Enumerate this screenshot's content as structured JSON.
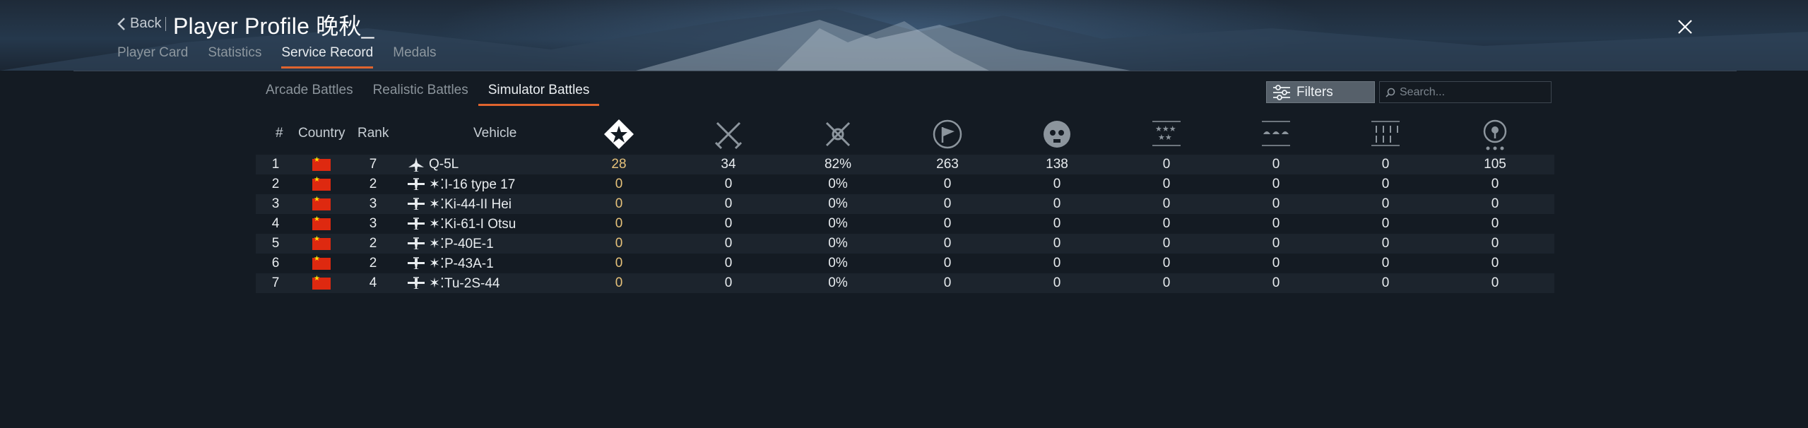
{
  "header": {
    "back_label": "Back",
    "title": "Player Profile 晚秋_",
    "tabs": [
      {
        "label": "Player Card",
        "active": false
      },
      {
        "label": "Statistics",
        "active": false
      },
      {
        "label": "Service Record",
        "active": true
      },
      {
        "label": "Medals",
        "active": false
      }
    ]
  },
  "battle_tabs": [
    {
      "label": "Arcade Battles",
      "active": false
    },
    {
      "label": "Realistic Battles",
      "active": false
    },
    {
      "label": "Simulator Battles",
      "active": true
    }
  ],
  "filters_label": "Filters",
  "search": {
    "placeholder": "Search...",
    "value": ""
  },
  "table": {
    "columns": {
      "index": "#",
      "country": "Country",
      "rank": "Rank",
      "vehicle": "Vehicle"
    },
    "stat_icons": [
      "battles-icon",
      "victories-icon",
      "win-rate-icon",
      "missions-icon",
      "kills-icon",
      "air-kills-icon",
      "ground-kills-icon",
      "naval-kills-icon",
      "activity-icon"
    ],
    "rows": [
      {
        "index": "1",
        "country": "China",
        "rank": "7",
        "vehicle": "Q-5L",
        "vehicle_type": "jet",
        "stats": [
          "28",
          "34",
          "82%",
          "263",
          "138",
          "0",
          "0",
          "0",
          "105"
        ]
      },
      {
        "index": "2",
        "country": "China",
        "rank": "2",
        "vehicle": "I-16 type 17",
        "vehicle_type": "prop",
        "stats": [
          "0",
          "0",
          "0%",
          "0",
          "0",
          "0",
          "0",
          "0",
          "0"
        ]
      },
      {
        "index": "3",
        "country": "China",
        "rank": "3",
        "vehicle": "Ki-44-II Hei",
        "vehicle_type": "prop",
        "stats": [
          "0",
          "0",
          "0%",
          "0",
          "0",
          "0",
          "0",
          "0",
          "0"
        ]
      },
      {
        "index": "4",
        "country": "China",
        "rank": "3",
        "vehicle": "Ki-61-I Otsu",
        "vehicle_type": "prop",
        "stats": [
          "0",
          "0",
          "0%",
          "0",
          "0",
          "0",
          "0",
          "0",
          "0"
        ]
      },
      {
        "index": "5",
        "country": "China",
        "rank": "2",
        "vehicle": "P-40E-1",
        "vehicle_type": "prop",
        "stats": [
          "0",
          "0",
          "0%",
          "0",
          "0",
          "0",
          "0",
          "0",
          "0"
        ]
      },
      {
        "index": "6",
        "country": "China",
        "rank": "2",
        "vehicle": "P-43A-1",
        "vehicle_type": "prop",
        "stats": [
          "0",
          "0",
          "0%",
          "0",
          "0",
          "0",
          "0",
          "0",
          "0"
        ]
      },
      {
        "index": "7",
        "country": "China",
        "rank": "4",
        "vehicle": "Tu-2S-44",
        "vehicle_type": "prop",
        "stats": [
          "0",
          "0",
          "0%",
          "0",
          "0",
          "0",
          "0",
          "0",
          "0"
        ]
      }
    ]
  },
  "colors": {
    "accent": "#e0642e",
    "highlight_value": "#e6c27a",
    "flag_red": "#de2910"
  }
}
